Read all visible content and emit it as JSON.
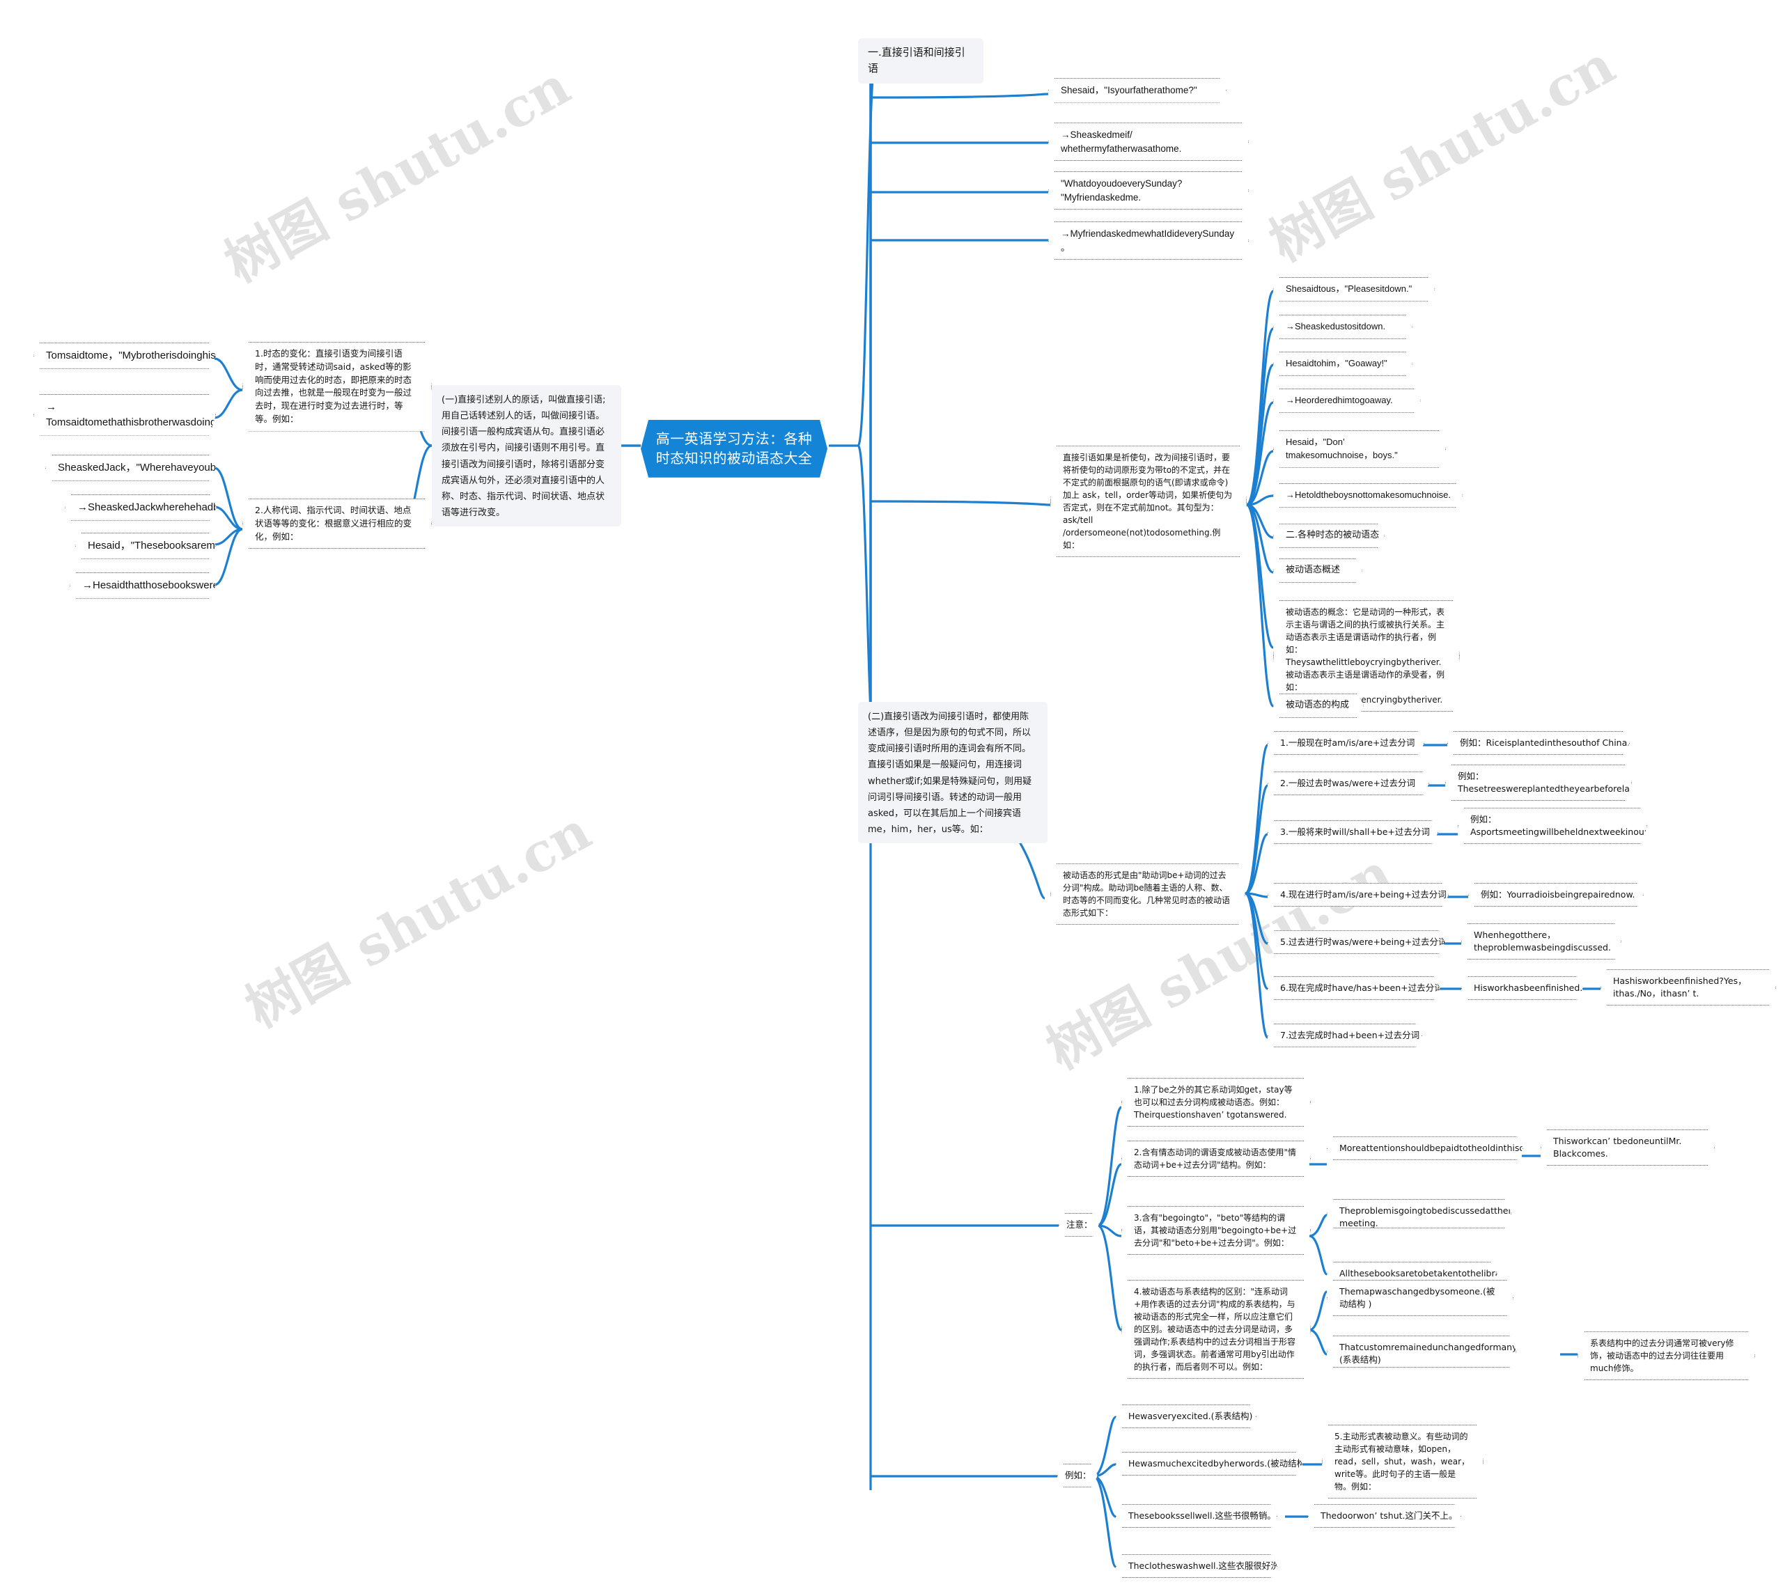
{
  "document": {
    "type": "mindmap",
    "watermarks": [
      "树图 shutu.cn",
      "树图 shutu.cn",
      "树图 shutu.cn",
      "树图shutu.cn"
    ],
    "accent_color": "#1484d7",
    "link_color": "#1c7fd0",
    "branch_bg": "#f2f4f7",
    "leaf_border": "#555555"
  },
  "root": {
    "label": "高一英语学习方法：各种时态知识的被动语态大全"
  },
  "left": {
    "branches": [
      {
        "id": "b1",
        "label": "(一)直接引述别人的原话，叫做直接引语;用自己话转述别人的话，叫做间接引语。间接引语一般构成宾语从句。直接引语必须放在引号内，间接引语则不用引号。直接引语改为间接引语时，除将引语部分变成宾语从句外，还必须对直接引语中的人称、时态、指示代词、时间状语、地点状语等进行改变。",
        "children": [
          {
            "id": "b1c1",
            "label": "1.时态的变化：直接引语变为间接引语时，通常受转述动词said，asked等的影响而使用过去化的时态，即把原来的时态向过去推，也就是一般现在时变为一般过去时，现在进行时变为过去进行时，等等。例如：",
            "children": [
              {
                "id": "l1",
                "label": "Tomsaidtome，\"Mybrotherisdoinghishomework.\""
              },
              {
                "id": "l2",
                "label": "→\nTomsaidtomethathisbrotherwasdoinghishomework."
              }
            ]
          },
          {
            "id": "b1c2",
            "label": "2.人称代词、指示代词、时间状语、地点状语等等的变化：根据意义进行相应的变化，例如：",
            "children": [
              {
                "id": "l3",
                "label": "SheaskedJack，\"Wherehaveyoubeen?\""
              },
              {
                "id": "l4",
                "label": "→SheaskedJackwherehehadbeen."
              },
              {
                "id": "l5",
                "label": "Hesaid，\"Thesebooksaremine.\""
              },
              {
                "id": "l6",
                "label": "→Hesaidthatthosebookswerehis."
              }
            ]
          }
        ]
      }
    ]
  },
  "right": {
    "branches": [
      {
        "id": "r1",
        "label": "一.直接引语和间接引语"
      },
      {
        "id": "r2",
        "label": "(二)直接引语改为间接引语时，都使用陈述语序，但是因为原句的句式不同，所以变成间接引语时所用的连词会有所不同。直接引语如果是一般疑问句，用连接词whether或if;如果是特殊疑问句，则用疑问词引导间接引语。转述的动词一般用asked，可以在其后加上一个间接宾语 me，him，her，us等。如："
      }
    ],
    "quote_examples": [
      {
        "id": "q1",
        "label": "Shesaid，\"Isyourfatherathome?\""
      },
      {
        "id": "q2",
        "label": "→Sheaskedmeif/\nwhethermyfatherwasathome."
      },
      {
        "id": "q3",
        "label": "\"WhatdoyoudoeverySunday?\n\"Myfriendaskedme."
      },
      {
        "id": "q4",
        "label": "→MyfriendaskedmewhatIdideverySunday\n。"
      }
    ],
    "imperative": {
      "label": "直接引语如果是祈使句，改为间接引语时，要将祈使句的动词原形变为带to的不定式，并在不定式的前面根据原句的语气(即请求或命令)加上 ask，tell，order等动词，如果祈使句为否定式，则在不定式前加not。其句型为：ask/tell /ordersomeone(not)todosomething.例如：",
      "examples": [
        {
          "id": "i1",
          "label": "Shesaidtous，\"Pleasesitdown.\""
        },
        {
          "id": "i2",
          "label": "→Sheaskedustositdown."
        },
        {
          "id": "i3",
          "label": "Hesaidtohim，\"Goaway!\""
        },
        {
          "id": "i4",
          "label": "→Heorderedhimtogoaway."
        },
        {
          "id": "i5",
          "label": "Hesaid，\"Don’ tmakesomuchnoise，boys.\""
        },
        {
          "id": "i6",
          "label": "→Hetoldtheboysnottomakesomuchnoise."
        }
      ]
    },
    "section_two": [
      {
        "id": "s1",
        "label": "二.各种时态的被动语态"
      },
      {
        "id": "s2",
        "label": "被动语态概述"
      },
      {
        "id": "s3",
        "label": "被动语态的概念：它是动词的一种形式，表示主语与谓语之间的执行或被执行关系。主动语态表示主语是谓语动作的执行者，例如：Theysawthelittleboycryingbytheriver.被动语态表示主语是谓语动作的承受者，例如：Thelittleboywasseencryingbytheriver."
      },
      {
        "id": "s4",
        "label": "被动语态的构成"
      }
    ],
    "formation": {
      "label": "被动语态的形式是由\"助动词be+动词的过去分词\"构成。助动词be随着主语的人称、数、时态等的不同而变化。几种常见时态的被动语态形式如下：",
      "tenses": [
        {
          "id": "t1",
          "label": "1.一般现在时am/is/are+过去分词",
          "example": "例如：Riceisplantedinthesouthof China."
        },
        {
          "id": "t2",
          "label": "2.一般过去时was/were+过去分词",
          "example": "例如：\nThesetreeswereplantedtheyearbeforelast."
        },
        {
          "id": "t3",
          "label": "3.一般将来时will/shall+be+过去分词",
          "example": "例如：\nAsportsmeetingwillbeheldnextweekinourschool."
        },
        {
          "id": "t4",
          "label": "4.现在进行时am/is/are+being+过去分词",
          "example": "例如：Yourradioisbeingrepairednow."
        },
        {
          "id": "t5",
          "label": "5.过去进行时was/were+being+过去分词",
          "example": "Whenhegotthere，\ntheproblemwasbeingdiscussed."
        },
        {
          "id": "t6",
          "label": "6.现在完成时have/has+been+过去分词",
          "example": "Hisworkhasbeenfinished.",
          "example2": "Hashisworkbeenfinished?Yes，ithas./No，ithasn’ t."
        },
        {
          "id": "t7",
          "label": "7.过去完成时had+been+过去分词",
          "example": ""
        }
      ]
    },
    "notes": {
      "label": "注意：",
      "items": [
        {
          "id": "n1",
          "label": "1.除了be之外的其它系动词如get，stay等也可以和过去分词构成被动语态。例如：Theirquestionshaven’ tgotanswered.",
          "children": []
        },
        {
          "id": "n2",
          "label": "2.含有情态动词的谓语变成被动语态使用\"情态动词+be+过去分词\"结构。例如：",
          "children": [
            {
              "id": "n2a",
              "label": "Moreattentionshouldbepaidtotheoldinthisociety.",
              "children": [
                {
                  "id": "n2a1",
                  "label": "Thisworkcan’ tbedoneuntilMr.\nBlackcomes."
                }
              ]
            }
          ]
        },
        {
          "id": "n3",
          "label": "3.含有\"begoingto\"，\"beto\"等结构的谓语，其被动语态分别用\"begoingto+be+过去分词\"和\"beto+be+过去分词\"。例如：",
          "children": [
            {
              "id": "n3a",
              "label": "Theproblemisgoingtobediscussedatthenext\nmeeting."
            },
            {
              "id": "n3b",
              "label": "Allthesebooksaretobetakentothelibrary."
            }
          ]
        },
        {
          "id": "n4",
          "label": "4.被动语态与系表结构的区别：\"连系动词+用作表语的过去分词\"构成的系表结构，与被动语态的形式完全一样，所以应注意它们的区别。被动语态中的过去分词是动词，多强调动作;系表结构中的过去分词相当于形容词，多强调状态。前者通常可用by引出动作的执行者，而后者则不可以。例如：",
          "children": [
            {
              "id": "n4a",
              "label": "Themapwaschangedbysomeone.(被动结构\n)"
            },
            {
              "id": "n4b",
              "label": "Thatcustomremainedunchangedformanycenturies.\n(系表结构)",
              "children": [
                {
                  "id": "n4b1",
                  "label": "系表结构中的过去分词通常可被very修饰，被动语态中的过去分词往往要用much修饰。"
                }
              ]
            }
          ]
        }
      ]
    },
    "examples_group": {
      "label": "例如：",
      "items": [
        {
          "id": "e1",
          "label": "Hewasveryexcited.(系表结构)"
        },
        {
          "id": "e2",
          "label": "Hewasmuchexcitedbyherwords.(被动结构)",
          "children": [
            {
              "id": "e2a",
              "label": "5.主动形式表被动意义。有些动词的主动形式有被动意味，如open，read，sell，shut，wash，wear，write等。此时句子的主语一般是物。例如："
            }
          ]
        },
        {
          "id": "e3",
          "label": "Thesebookssellwell.这些书很畅销。",
          "children": [
            {
              "id": "e3a",
              "label": "Thedoorwon’ tshut.这门关不上。"
            }
          ]
        },
        {
          "id": "e4",
          "label": "Theclotheswashwell.这些衣服很好洗。"
        }
      ]
    }
  }
}
